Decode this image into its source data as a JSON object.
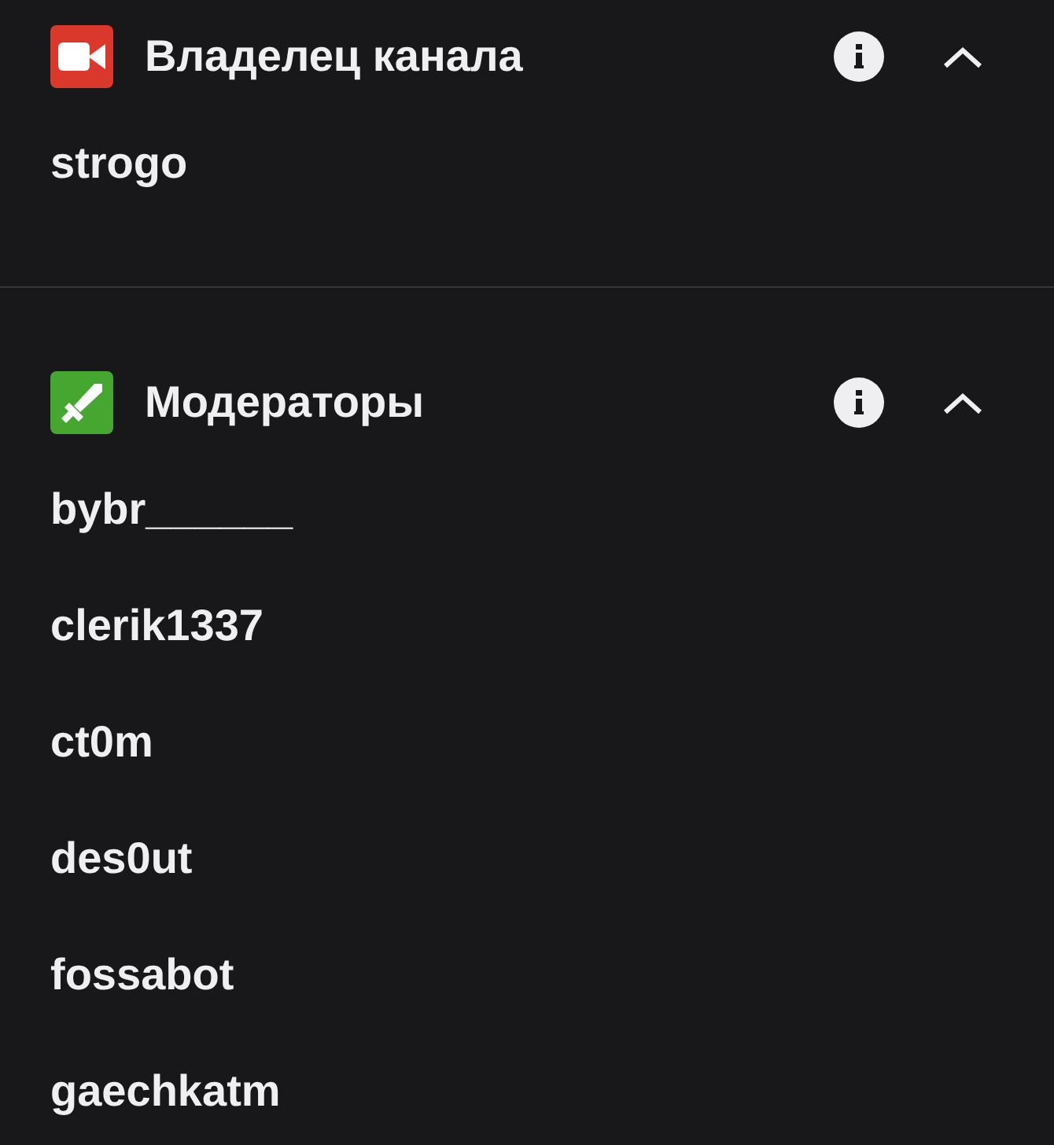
{
  "sections": [
    {
      "kind": "owner",
      "title": "Владелец канала",
      "expanded": true,
      "users": [
        "strogo"
      ]
    },
    {
      "kind": "moderators",
      "title": "Модераторы",
      "expanded": true,
      "users": [
        "bybr______",
        "clerik1337",
        "ct0m",
        "des0ut",
        "fossabot",
        "gaechkatm"
      ]
    }
  ]
}
